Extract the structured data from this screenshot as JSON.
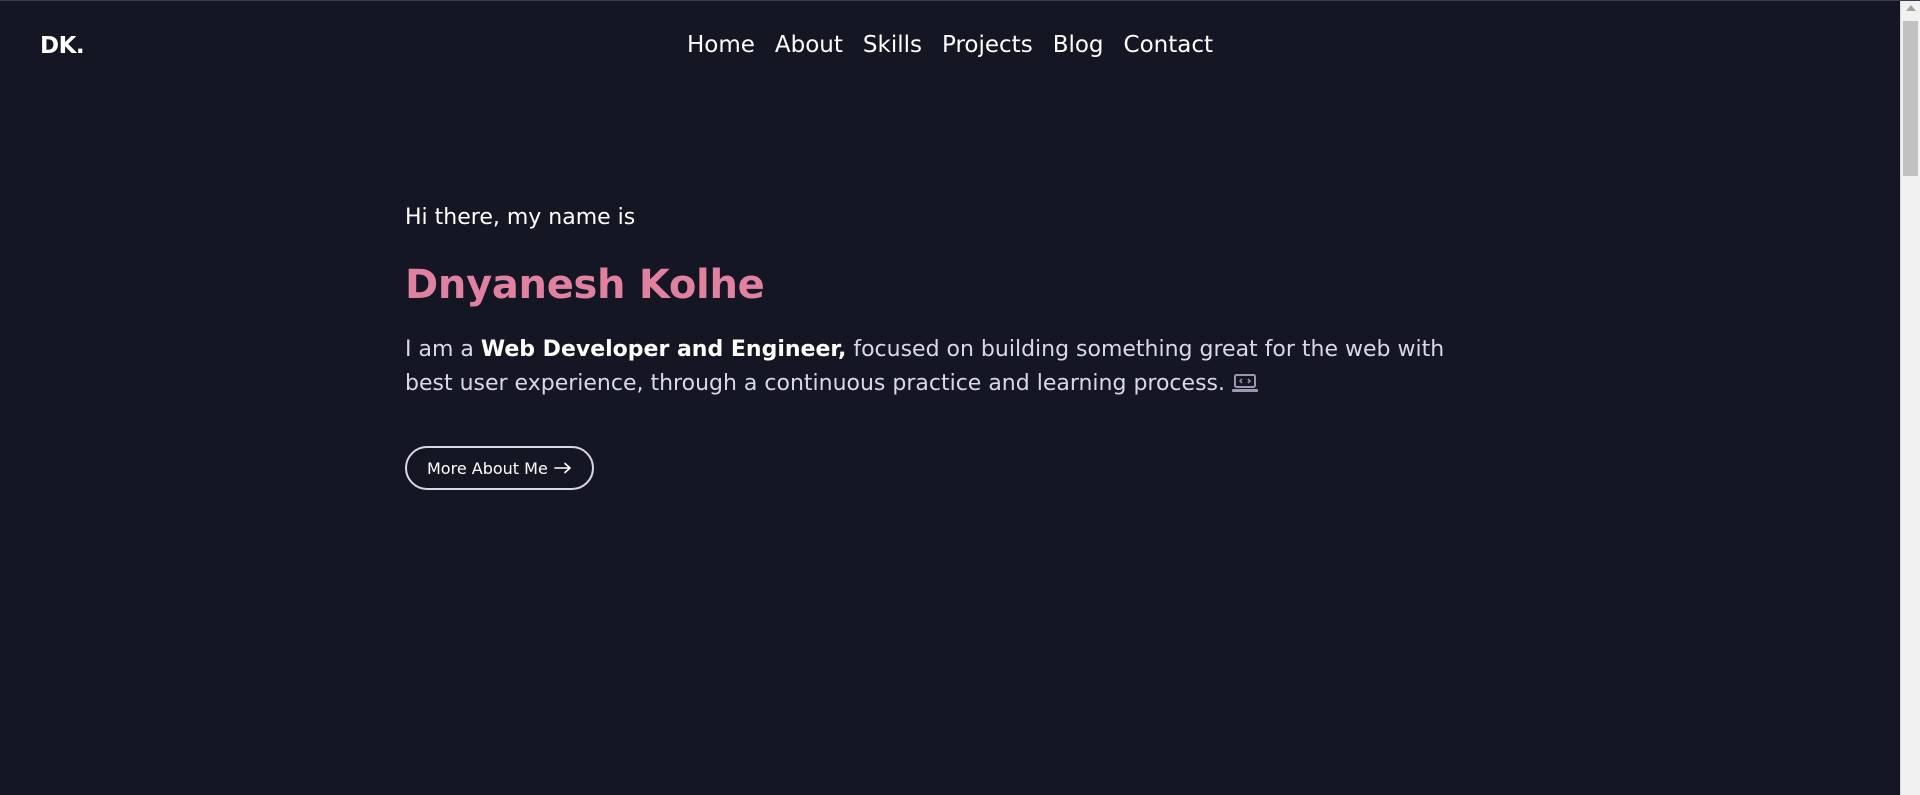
{
  "header": {
    "logo": "DK.",
    "nav": [
      "Home",
      "About",
      "Skills",
      "Projects",
      "Blog",
      "Contact"
    ]
  },
  "hero": {
    "greeting": "Hi there, my name is",
    "name": "Dnyanesh Kolhe",
    "intro_prefix": "I am a ",
    "intro_bold": "Web Developer and Engineer,",
    "intro_suffix": " focused on building something great for the web with best user experience, through a continuous practice and learning process.",
    "intro_icon": "laptop-code-icon",
    "button_label": "More About Me",
    "button_icon": "arrow-right-icon"
  },
  "colors": {
    "background": "#151624",
    "accent": "#e0829f",
    "text": "#ffffff",
    "muted_text": "#d9d7ea"
  }
}
